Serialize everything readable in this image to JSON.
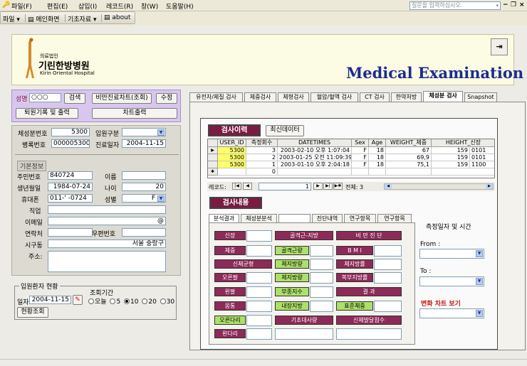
{
  "menubar": {
    "items": [
      "파일(F)",
      "편집(E)",
      "삽입(I)",
      "레코드(R)",
      "창(W)",
      "도움말(H)"
    ],
    "help_placeholder": "질문을 입력하십시오."
  },
  "toolbar": {
    "items": [
      "파일",
      "메인화면",
      "기초자료",
      "about"
    ]
  },
  "header": {
    "logo_small": "의료법인",
    "logo_name": "기린한방병원",
    "logo_en": "Kirin Oriental Hospital",
    "title": "Medical Examination"
  },
  "search": {
    "name_label": "성명",
    "name_value": "○○○",
    "search_btn": "검색",
    "chart_btn": "비만진료차트(조회)",
    "edit_btn": "수정",
    "discharge_btn": "퇴원기록 및 출력",
    "chart_print_btn": "차트출력"
  },
  "patient": {
    "bodycomp_label": "체성분번호",
    "bodycomp_value": "5300",
    "admit_type_label": "입원구분",
    "record_label": "병록번호",
    "record_value": "000005300",
    "visit_label": "진료일자",
    "visit_value": "2004-11-15",
    "basic_info_title": "기본정보",
    "rrn_label": "주민번호",
    "rrn_value": "840724",
    "name_label": "이름",
    "dob_label": "생년월일",
    "dob_value": "1984-07-24",
    "age_label": "나이",
    "age_value": "20",
    "phone_label": "휴대폰",
    "phone_value": "011-'   -0724",
    "sex_label": "성별",
    "sex_value": "F",
    "job_label": "직업",
    "email_label": "이메일",
    "email_value": "@",
    "contact_label": "연락처",
    "zip_label": "우편번호",
    "district_label": "시구동",
    "district_value": "서울 중랑구",
    "address_label": "주소:"
  },
  "admitted": {
    "title": "입원환자 현황",
    "date_label": "일자",
    "date_value": "2004-11-15",
    "period_label": "조회기간",
    "options": [
      "오늘",
      "5",
      "10",
      "20",
      "30"
    ],
    "selected_index": 2,
    "status_btn": "현황조회"
  },
  "tabs": [
    "유전자/체질 검사",
    "체중검사",
    "체형검사",
    "혈압/혈액 검사",
    "CT 검사",
    "한약처방",
    "체성분 검사",
    "Snapshot"
  ],
  "active_tab_index": 6,
  "history": {
    "title": "검사이력",
    "latest_btn": "최신데이터",
    "columns": [
      "USER_ID",
      "측정회수",
      "DATETIMES",
      "Sex",
      "Age",
      "WEIGHT_체중",
      "HEIGHT_신장"
    ],
    "rows": [
      {
        "marker": "▶",
        "cells": [
          "5300",
          "3",
          "2003-02-10 오후 1:07:04",
          "F",
          "18",
          "67",
          "159"
        ],
        "extra": "0101"
      },
      {
        "marker": "",
        "cells": [
          "5300",
          "2",
          "2003-01-25 오전 11:09:39",
          "F",
          "18",
          "69,9",
          "159"
        ],
        "extra": "0101"
      },
      {
        "marker": "",
        "cells": [
          "5300",
          "1",
          "2003-01-10 오후 2:04:18",
          "F",
          "18",
          "75,1",
          "159"
        ],
        "extra": "1100"
      },
      {
        "marker": "✱",
        "cells": [
          "",
          "0",
          "",
          "",
          "",
          "",
          ""
        ],
        "extra": ""
      }
    ],
    "nav_label": "레코드:",
    "nav_current": "1",
    "nav_total": "전체: 3"
  },
  "content": {
    "title": "검사내용",
    "inner_tabs": [
      "분석결과",
      "체성분분석",
      "",
      "진단내역",
      "연구항목",
      "연구항목"
    ],
    "buttons": {
      "c1": [
        "신장",
        "체중",
        "신체균형",
        "오른팔",
        "왼팔",
        "몸통",
        "오른다리",
        "왼다리"
      ],
      "c2": [
        "골격근-지방",
        "골격근량",
        "체지방량",
        "체지방량",
        "부종지수",
        "내장지방",
        "기초대사량"
      ],
      "c3": [
        "비 만 진 단",
        "B M I",
        "체지방률",
        "복부지방률",
        "결        과",
        "표준체중",
        "신체발달점수"
      ]
    },
    "side_title": "측정일자 및 시간",
    "from_label": "From :",
    "to_label": "To :",
    "change_chart_label": "변화 차트 보기"
  },
  "colors": {
    "accent_dark": "#7b1a42",
    "button_magenta": "#8c2a58",
    "button_green": "#ace06a",
    "title_blue": "#1a2d8f",
    "highlight_red": "#c81414"
  }
}
